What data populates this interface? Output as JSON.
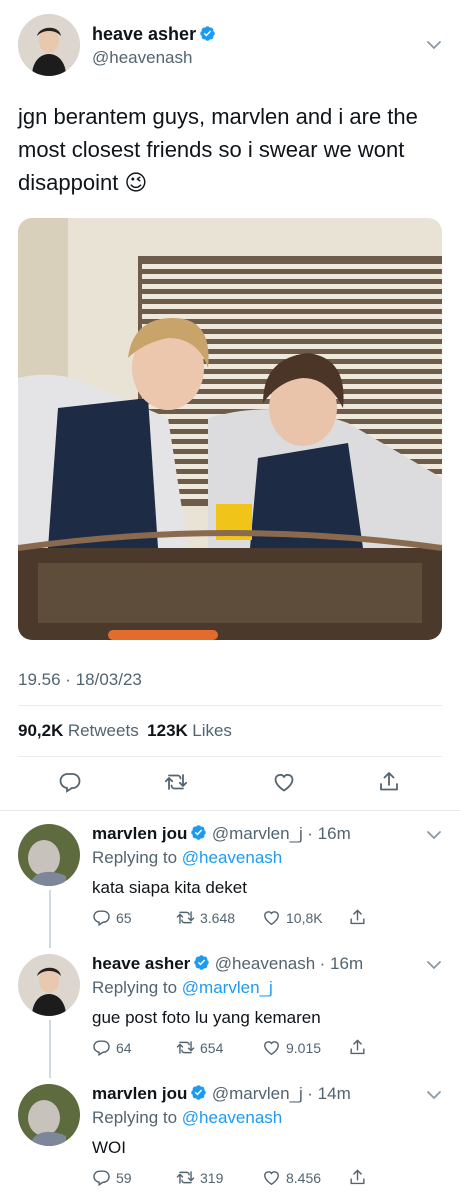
{
  "main_tweet": {
    "name": "heave asher",
    "handle": "@heavenash",
    "text": "jgn berantem guys, marvlen and i are the most closest friends so i swear we wont disappoint 😉",
    "time": "19.56",
    "date": "18/03/23",
    "separator": "·",
    "retweets_count": "90,2K",
    "retweets_label": "Retweets",
    "likes_count": "123K",
    "likes_label": "Likes"
  },
  "replies": [
    {
      "name": "marvlen jou",
      "handle": "@marvlen_j",
      "time": "· 16m",
      "replying_prefix": "Replying to",
      "replying_to": "@heavenash",
      "text": "kata siapa kita deket",
      "replies": "65",
      "retweets": "3.648",
      "likes": "10,8K"
    },
    {
      "name": "heave asher",
      "handle": "@heavenash",
      "time": "· 16m",
      "replying_prefix": "Replying to",
      "replying_to": "@marvlen_j",
      "text": "gue post foto lu yang kemaren",
      "replies": "64",
      "retweets": "654",
      "likes": "9.015"
    },
    {
      "name": "marvlen jou",
      "handle": "@marvlen_j",
      "time": "· 14m",
      "replying_prefix": "Replying to",
      "replying_to": "@heavenash",
      "text": "WOI",
      "replies": "59",
      "retweets": "319",
      "likes": "8.456"
    }
  ],
  "colors": {
    "verified": "#1d9bf0",
    "link": "#1d9bf0",
    "secondary_text": "#536471",
    "divider": "#e6ecf0"
  },
  "icons": [
    "verified-badge-icon",
    "chevron-down-icon",
    "reply-icon",
    "retweet-icon",
    "like-icon",
    "share-icon"
  ]
}
